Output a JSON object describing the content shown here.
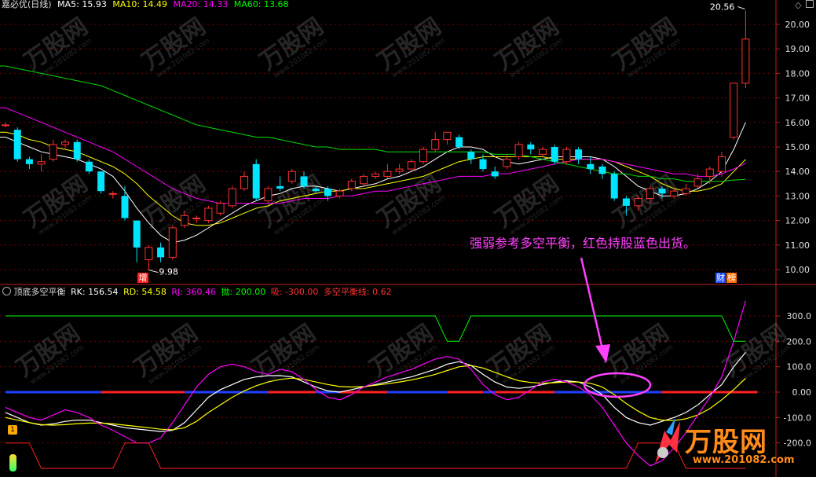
{
  "header": {
    "title": "嘉必优(日线)",
    "ma5": {
      "label": "MA5:",
      "value": "15.93",
      "color": "#ffffff"
    },
    "ma10": {
      "label": "MA10:",
      "value": "14.49",
      "color": "#ffff00"
    },
    "ma20": {
      "label": "MA20:",
      "value": "14.33",
      "color": "#ff00ff"
    },
    "ma60": {
      "label": "MA60:",
      "value": "13.68",
      "color": "#00ff00"
    }
  },
  "indicator_header": {
    "title": "顶底多空平衡",
    "rk": {
      "label": "RK:",
      "value": "156.54",
      "color": "#ffffff"
    },
    "rd": {
      "label": "RD:",
      "value": "54.58",
      "color": "#ffff00"
    },
    "rj": {
      "label": "RJ:",
      "value": "360.46",
      "color": "#ff00ff"
    },
    "pao": {
      "label": "抛:",
      "value": "200.00",
      "color": "#00ff00"
    },
    "xi": {
      "label": "吸:",
      "value": "-300.00",
      "color": "#ff3030"
    },
    "balance": {
      "label": "多空平衡线:",
      "value": "0.62",
      "color": "#ff3030"
    }
  },
  "annotations": {
    "high_label": "20.56",
    "low_label": "9.98",
    "zeng_badge": "增",
    "cai_badge": "财",
    "bang_badge": "榜",
    "callout_text": "强弱参考多空平衡，红色持股蓝色出货。",
    "alert_badge": "1",
    "callout_color": "#ff40ff"
  },
  "watermark": {
    "text": "万股网",
    "url": "www.201082.com"
  },
  "chart_data": [
    {
      "type": "candlestick",
      "title": "嘉必优(日线)",
      "ylim": [
        9.6,
        20.8
      ],
      "yticks": [
        "20.00",
        "19.00",
        "18.00",
        "17.00",
        "16.00",
        "15.00",
        "14.00",
        "13.00",
        "12.00",
        "11.00",
        "10.00"
      ],
      "up_color": "#ff3030",
      "down_color": "#00e5ff",
      "candles": [
        [
          15.9,
          15.9,
          16.0,
          15.8
        ],
        [
          15.7,
          14.5,
          15.8,
          14.4
        ],
        [
          14.5,
          14.3,
          14.6,
          14.1
        ],
        [
          14.3,
          14.4,
          14.7,
          14.0
        ],
        [
          14.5,
          15.1,
          15.3,
          14.4
        ],
        [
          15.1,
          15.2,
          15.3,
          14.9
        ],
        [
          15.2,
          14.5,
          15.3,
          14.4
        ],
        [
          14.4,
          14.0,
          14.5,
          13.9
        ],
        [
          14.0,
          13.2,
          14.0,
          13.1
        ],
        [
          13.1,
          13.1,
          13.2,
          12.9
        ],
        [
          13.0,
          12.1,
          13.4,
          12.0
        ],
        [
          12.0,
          10.9,
          12.0,
          10.3
        ],
        [
          10.4,
          10.9,
          11.0,
          9.98
        ],
        [
          10.9,
          10.5,
          11.1,
          10.3
        ],
        [
          10.5,
          11.7,
          11.8,
          10.4
        ],
        [
          11.8,
          12.2,
          12.4,
          11.7
        ],
        [
          12.1,
          12.1,
          12.2,
          11.9
        ],
        [
          12.0,
          12.5,
          12.6,
          11.9
        ],
        [
          12.3,
          12.7,
          12.8,
          12.2
        ],
        [
          12.6,
          13.3,
          13.4,
          12.5
        ],
        [
          13.3,
          13.8,
          14.0,
          13.2
        ],
        [
          14.3,
          12.9,
          14.5,
          12.8
        ],
        [
          12.8,
          13.3,
          13.4,
          12.7
        ],
        [
          13.4,
          13.3,
          13.8,
          13.2
        ],
        [
          13.6,
          14.0,
          14.1,
          13.5
        ],
        [
          13.8,
          13.4,
          14.0,
          13.3
        ],
        [
          13.3,
          13.2,
          13.4,
          13.1
        ],
        [
          13.3,
          13.0,
          13.4,
          12.8
        ],
        [
          13.0,
          13.2,
          13.3,
          12.9
        ],
        [
          13.3,
          13.6,
          13.7,
          13.2
        ],
        [
          13.5,
          13.8,
          13.9,
          13.4
        ],
        [
          13.8,
          13.9,
          14.0,
          13.7
        ],
        [
          13.8,
          14.0,
          14.3,
          13.7
        ],
        [
          14.0,
          14.1,
          14.3,
          13.9
        ],
        [
          14.1,
          14.4,
          14.5,
          14.0
        ],
        [
          14.4,
          14.9,
          15.0,
          14.3
        ],
        [
          14.9,
          15.3,
          15.6,
          14.8
        ],
        [
          15.3,
          15.6,
          15.6,
          15.1
        ],
        [
          15.4,
          15.0,
          15.5,
          14.9
        ],
        [
          14.8,
          14.5,
          14.9,
          14.3
        ],
        [
          14.5,
          14.1,
          14.7,
          14.0
        ],
        [
          14.0,
          13.8,
          14.2,
          13.7
        ],
        [
          14.2,
          14.5,
          14.7,
          14.1
        ],
        [
          14.6,
          15.1,
          15.2,
          14.5
        ],
        [
          15.1,
          14.9,
          15.2,
          14.7
        ],
        [
          14.7,
          14.9,
          15.0,
          14.6
        ],
        [
          15.0,
          14.4,
          15.1,
          14.3
        ],
        [
          14.4,
          14.9,
          15.0,
          14.3
        ],
        [
          14.9,
          14.5,
          15.0,
          14.3
        ],
        [
          14.3,
          14.1,
          14.6,
          13.9
        ],
        [
          14.2,
          13.9,
          14.3,
          13.7
        ],
        [
          13.9,
          12.9,
          14.0,
          12.8
        ],
        [
          12.9,
          12.6,
          13.0,
          12.2
        ],
        [
          12.6,
          12.9,
          13.0,
          12.4
        ],
        [
          12.9,
          13.3,
          13.4,
          12.7
        ],
        [
          13.3,
          13.1,
          13.4,
          12.9
        ],
        [
          13.0,
          13.2,
          13.3,
          12.9
        ],
        [
          13.1,
          13.3,
          13.5,
          13.0
        ],
        [
          13.4,
          13.7,
          13.9,
          13.3
        ],
        [
          13.8,
          14.1,
          14.2,
          13.5
        ],
        [
          14.0,
          14.6,
          14.8,
          13.8
        ],
        [
          15.4,
          17.6,
          17.6,
          15.3
        ],
        [
          17.6,
          19.4,
          20.56,
          17.4
        ]
      ],
      "ma_series": [
        {
          "name": "MA5",
          "color": "#ffffff",
          "values": [
            15.4,
            15.2,
            15.0,
            14.8,
            14.7,
            14.6,
            14.5,
            14.3,
            14.1,
            13.8,
            13.2,
            12.5,
            11.9,
            11.4,
            11.1,
            11.2,
            11.4,
            11.7,
            12.0,
            12.3,
            12.6,
            12.8,
            13.0,
            13.1,
            13.3,
            13.4,
            13.4,
            13.3,
            13.2,
            13.3,
            13.4,
            13.5,
            13.7,
            13.8,
            14.0,
            14.2,
            14.5,
            14.8,
            15.0,
            15.0,
            14.9,
            14.6,
            14.4,
            14.3,
            14.4,
            14.5,
            14.6,
            14.6,
            14.6,
            14.6,
            14.5,
            14.2,
            13.8,
            13.4,
            13.2,
            13.0,
            13.0,
            13.1,
            13.3,
            13.6,
            14.0,
            14.9,
            16.0
          ]
        },
        {
          "name": "MA10",
          "color": "#ffff00",
          "values": [
            15.6,
            15.5,
            15.3,
            15.2,
            15.0,
            14.9,
            14.8,
            14.6,
            14.4,
            14.2,
            13.9,
            13.5,
            13.0,
            12.6,
            12.2,
            11.9,
            11.8,
            11.8,
            11.9,
            12.1,
            12.3,
            12.5,
            12.6,
            12.8,
            12.9,
            13.0,
            13.1,
            13.2,
            13.2,
            13.3,
            13.3,
            13.4,
            13.5,
            13.6,
            13.7,
            13.8,
            14.0,
            14.2,
            14.4,
            14.5,
            14.6,
            14.6,
            14.6,
            14.6,
            14.6,
            14.6,
            14.5,
            14.5,
            14.5,
            14.5,
            14.5,
            14.4,
            14.2,
            14.0,
            13.8,
            13.5,
            13.3,
            13.2,
            13.2,
            13.3,
            13.5,
            14.0,
            14.49
          ]
        },
        {
          "name": "MA20",
          "color": "#ff00ff",
          "values": [
            16.6,
            16.4,
            16.2,
            16.0,
            15.8,
            15.6,
            15.4,
            15.2,
            15.0,
            14.8,
            14.5,
            14.2,
            13.9,
            13.6,
            13.3,
            13.1,
            12.9,
            12.8,
            12.7,
            12.7,
            12.7,
            12.7,
            12.7,
            12.7,
            12.8,
            12.9,
            12.9,
            12.9,
            13.0,
            13.0,
            13.1,
            13.2,
            13.2,
            13.3,
            13.4,
            13.5,
            13.6,
            13.7,
            13.8,
            13.8,
            13.8,
            13.9,
            13.9,
            14.0,
            14.1,
            14.2,
            14.3,
            14.4,
            14.5,
            14.5,
            14.5,
            14.4,
            14.3,
            14.2,
            14.1,
            14.0,
            13.9,
            13.9,
            13.8,
            13.8,
            13.9,
            14.1,
            14.33
          ]
        },
        {
          "name": "MA60",
          "color": "#00dd00",
          "values": [
            18.3,
            18.2,
            18.1,
            18.0,
            17.9,
            17.8,
            17.7,
            17.6,
            17.5,
            17.3,
            17.1,
            16.9,
            16.7,
            16.5,
            16.3,
            16.1,
            15.9,
            15.8,
            15.7,
            15.6,
            15.5,
            15.4,
            15.4,
            15.3,
            15.2,
            15.1,
            15.0,
            15.0,
            14.9,
            14.9,
            14.9,
            14.9,
            14.8,
            14.8,
            14.8,
            14.8,
            14.8,
            14.8,
            14.8,
            14.8,
            14.8,
            14.7,
            14.7,
            14.7,
            14.6,
            14.5,
            14.4,
            14.3,
            14.2,
            14.1,
            14.0,
            13.9,
            13.9,
            13.8,
            13.8,
            13.7,
            13.7,
            13.6,
            13.6,
            13.6,
            13.6,
            13.65,
            13.68
          ]
        }
      ]
    },
    {
      "type": "line",
      "title": "顶底多空平衡",
      "ylim": [
        -320,
        420
      ],
      "yticks": [
        "300.0",
        "200.0",
        "100.0",
        "0.00",
        "-100.0",
        "-200.0"
      ],
      "series": [
        {
          "name": "RK",
          "color": "#ffffff",
          "values": [
            -80,
            -100,
            -120,
            -130,
            -125,
            -115,
            -110,
            -110,
            -120,
            -130,
            -140,
            -145,
            -150,
            -155,
            -150,
            -120,
            -70,
            -20,
            10,
            30,
            50,
            60,
            65,
            65,
            60,
            40,
            20,
            5,
            0,
            10,
            20,
            30,
            40,
            50,
            60,
            75,
            90,
            110,
            120,
            105,
            70,
            40,
            20,
            15,
            20,
            30,
            40,
            45,
            40,
            20,
            -10,
            -60,
            -100,
            -120,
            -130,
            -115,
            -100,
            -80,
            -50,
            -10,
            30,
            100,
            156.54
          ]
        },
        {
          "name": "RD",
          "color": "#ffff00",
          "values": [
            -100,
            -110,
            -120,
            -128,
            -130,
            -128,
            -124,
            -122,
            -122,
            -125,
            -130,
            -135,
            -140,
            -146,
            -148,
            -140,
            -115,
            -80,
            -50,
            -20,
            5,
            25,
            40,
            50,
            55,
            50,
            40,
            30,
            22,
            20,
            22,
            27,
            33,
            40,
            48,
            58,
            70,
            85,
            100,
            105,
            95,
            78,
            60,
            45,
            38,
            35,
            37,
            40,
            40,
            35,
            20,
            -10,
            -45,
            -75,
            -100,
            -110,
            -112,
            -105,
            -90,
            -65,
            -30,
            10,
            54.58
          ]
        },
        {
          "name": "RJ",
          "color": "#ff00ff",
          "values": [
            -60,
            -80,
            -100,
            -110,
            -90,
            -70,
            -80,
            -100,
            -130,
            -150,
            -175,
            -200,
            -200,
            -180,
            -120,
            -50,
            20,
            70,
            100,
            110,
            100,
            80,
            70,
            90,
            80,
            50,
            10,
            -20,
            -30,
            -10,
            20,
            40,
            60,
            75,
            90,
            110,
            130,
            140,
            130,
            90,
            30,
            -10,
            -30,
            -20,
            10,
            40,
            50,
            40,
            20,
            -10,
            -60,
            -130,
            -200,
            -250,
            -290,
            -270,
            -220,
            -160,
            -90,
            -20,
            60,
            200,
            360.46
          ]
        },
        {
          "name": "抛",
          "color": "#00ff00",
          "values": [
            300,
            300,
            300,
            300,
            300,
            300,
            300,
            300,
            300,
            300,
            300,
            300,
            300,
            300,
            300,
            300,
            300,
            300,
            300,
            300,
            300,
            300,
            300,
            300,
            300,
            300,
            300,
            300,
            300,
            300,
            300,
            300,
            300,
            300,
            300,
            300,
            300,
            200,
            200,
            300,
            300,
            300,
            300,
            300,
            300,
            300,
            300,
            300,
            300,
            300,
            300,
            300,
            300,
            300,
            300,
            300,
            300,
            300,
            300,
            300,
            300,
            200,
            200
          ]
        },
        {
          "name": "吸",
          "color": "#ff2020",
          "values": [
            -200,
            -200,
            -200,
            -300,
            -300,
            -300,
            -300,
            -300,
            -300,
            -300,
            -200,
            -200,
            -200,
            -300,
            -300,
            -300,
            -300,
            -300,
            -300,
            -300,
            -300,
            -300,
            -300,
            -300,
            -300,
            -300,
            -300,
            -300,
            -300,
            -300,
            -300,
            -300,
            -300,
            -300,
            -300,
            -300,
            -300,
            -300,
            -300,
            -300,
            -300,
            -300,
            -300,
            -300,
            -300,
            -300,
            -300,
            -300,
            -300,
            -300,
            -300,
            -300,
            -300,
            -200,
            -200,
            -200,
            -200,
            -300,
            -300,
            -300,
            -300,
            -300,
            -300
          ]
        }
      ],
      "balance_segments": [
        {
          "from": 0,
          "to": 8,
          "color": "#2040ff"
        },
        {
          "from": 8,
          "to": 15,
          "color": "#ff2020"
        },
        {
          "from": 15,
          "to": 22,
          "color": "#2040ff"
        },
        {
          "from": 22,
          "to": 26,
          "color": "#ff2020"
        },
        {
          "from": 26,
          "to": 28,
          "color": "#2040ff"
        },
        {
          "from": 28,
          "to": 32,
          "color": "#ff2020"
        },
        {
          "from": 32,
          "to": 37,
          "color": "#2040ff"
        },
        {
          "from": 37,
          "to": 40,
          "color": "#ff2020"
        },
        {
          "from": 40,
          "to": 41,
          "color": "#2040ff"
        },
        {
          "from": 41,
          "to": 46,
          "color": "#ff2020"
        },
        {
          "from": 46,
          "to": 55,
          "color": "#2040ff"
        },
        {
          "from": 55,
          "to": 63,
          "color": "#ff2020"
        }
      ]
    }
  ]
}
